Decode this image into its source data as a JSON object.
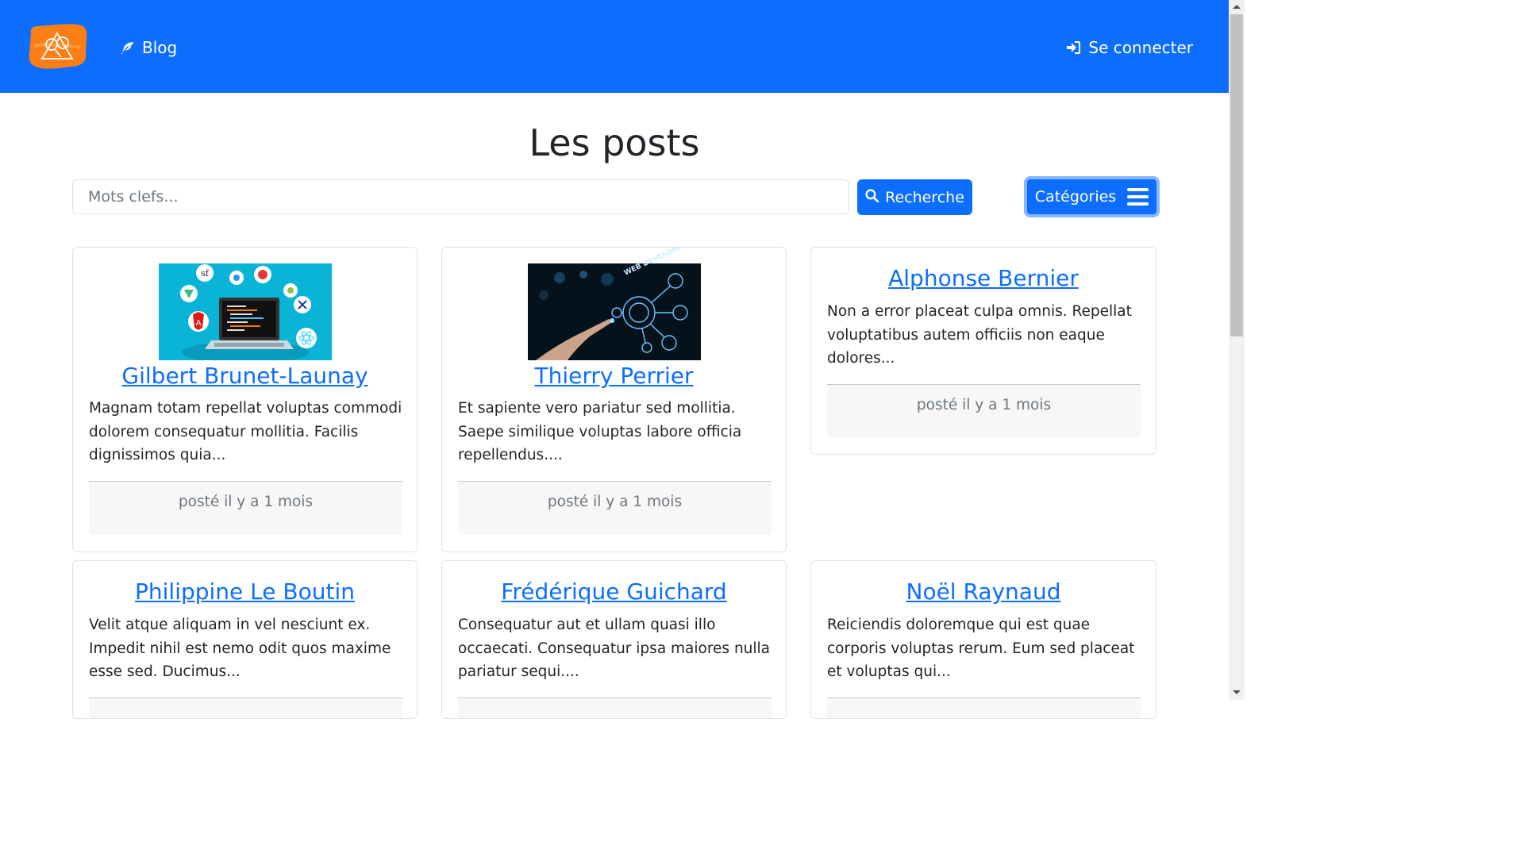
{
  "navbar": {
    "logo_icon": "brand-logo-icon",
    "blog_label": "Blog",
    "blog_icon": "feather-icon",
    "login_label": "Se connecter",
    "login_icon": "sign-in-icon",
    "brand_color": "#0d6efd",
    "logo_color": "#fd7e14"
  },
  "page": {
    "title": "Les posts"
  },
  "search": {
    "placeholder": "Mots clefs...",
    "value": "",
    "button_label": "Recherche",
    "button_icon": "search-icon"
  },
  "categories": {
    "button_label": "Catégories",
    "button_icon": "hamburger-menu-icon"
  },
  "posts": [
    {
      "title": "Gilbert Brunet-Launay",
      "excerpt": "Magnam totam repellat voluptas commodi dolorem consequatur mollitia. Facilis dignissimos quia...",
      "date": "posté il y a 1 mois",
      "image": "laptop-frameworks-illustration"
    },
    {
      "title": "Thierry Perrier",
      "excerpt": "Et sapiente vero pariatur sed mollitia. Saepe similique voluptas labore officia repellendus....",
      "date": "posté il y a 1 mois",
      "image": "web-development-touch-illustration",
      "image_caption": "WEB DEVELOPMENT"
    },
    {
      "title": "Alphonse Bernier",
      "excerpt": "Non a error placeat culpa omnis. Repellat voluptatibus autem officiis non eaque dolores...",
      "date": "posté il y a 1 mois"
    },
    {
      "title": "Philippine Le Boutin",
      "excerpt": "Velit atque aliquam in vel nesciunt ex. Impedit nihil est nemo odit quos maxime esse sed. Ducimus..."
    },
    {
      "title": "Frédérique Guichard",
      "excerpt": "Consequatur aut et ullam quasi illo occaecati. Consequatur ipsa maiores nulla pariatur sequi...."
    },
    {
      "title": "Noël Raynaud",
      "excerpt": "Reiciendis doloremque qui est quae corporis voluptas rerum. Eum sed placeat et voluptas qui..."
    }
  ]
}
